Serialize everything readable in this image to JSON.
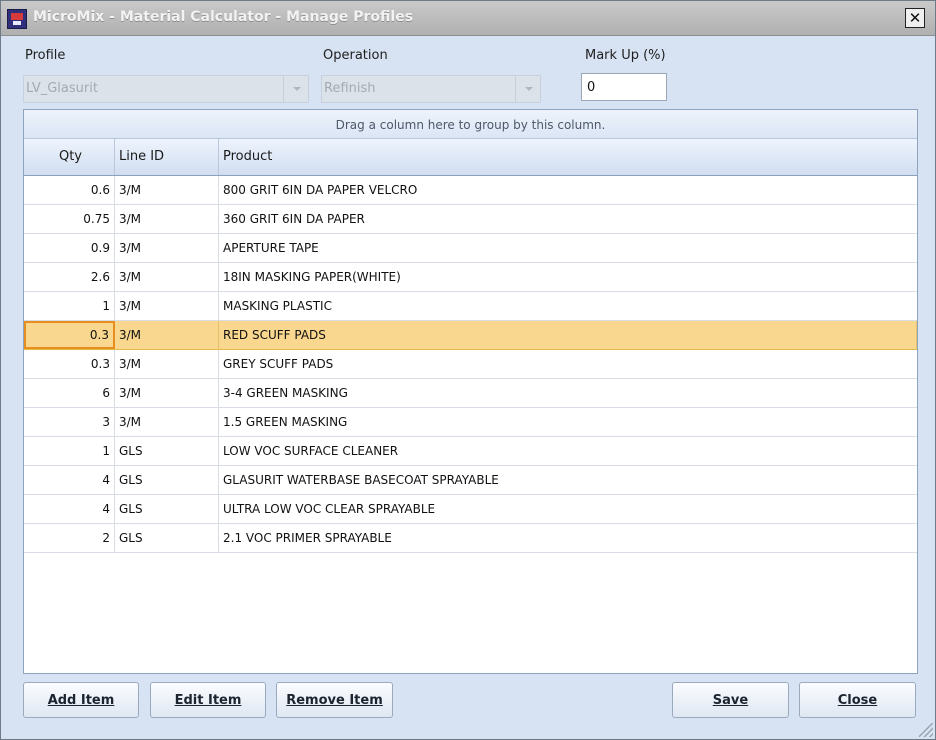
{
  "window": {
    "title": "MicroMix - Material Calculator - Manage Profiles",
    "close_symbol": "✕"
  },
  "filters": {
    "profile_label": "Profile",
    "profile_value": "LV_Glasurit",
    "operation_label": "Operation",
    "operation_value": "Refinish",
    "markup_label": "Mark Up (%)",
    "markup_value": "0"
  },
  "grid": {
    "group_hint": "Drag a column here to group by this column.",
    "columns": [
      "Qty",
      "Line ID",
      "Product"
    ],
    "rows": [
      {
        "qty": "0.6",
        "line_id": "3/M",
        "product": "800 GRIT 6IN DA PAPER VELCRO"
      },
      {
        "qty": "0.75",
        "line_id": "3/M",
        "product": "360 GRIT 6IN DA PAPER"
      },
      {
        "qty": "0.9",
        "line_id": "3/M",
        "product": "APERTURE TAPE"
      },
      {
        "qty": "2.6",
        "line_id": "3/M",
        "product": "18IN MASKING PAPER(WHITE)"
      },
      {
        "qty": "1",
        "line_id": "3/M",
        "product": "MASKING PLASTIC"
      },
      {
        "qty": "0.3",
        "line_id": "3/M",
        "product": "RED SCUFF PADS"
      },
      {
        "qty": "0.3",
        "line_id": "3/M",
        "product": "GREY SCUFF PADS"
      },
      {
        "qty": "6",
        "line_id": "3/M",
        "product": "3-4 GREEN MASKING"
      },
      {
        "qty": "3",
        "line_id": "3/M",
        "product": "1.5 GREEN MASKING"
      },
      {
        "qty": "1",
        "line_id": "GLS",
        "product": "LOW VOC SURFACE CLEANER"
      },
      {
        "qty": "4",
        "line_id": "GLS",
        "product": "GLASURIT WATERBASE BASECOAT SPRAYABLE"
      },
      {
        "qty": "4",
        "line_id": "GLS",
        "product": "ULTRA LOW VOC CLEAR SPRAYABLE"
      },
      {
        "qty": "2",
        "line_id": "GLS",
        "product": "2.1 VOC PRIMER SPRAYABLE"
      }
    ],
    "selected_row_index": 5
  },
  "buttons": {
    "add": "Add Item",
    "edit": "Edit Item",
    "remove": "Remove Item",
    "save": "Save",
    "close": "Close"
  },
  "colors": {
    "selection": "#f9d78e",
    "selection_border": "#e68f1f",
    "window_bg": "#d7e3f2"
  },
  "icons": {
    "app": "micromix-app-icon",
    "close": "close-icon",
    "dropdown": "chevron-down-icon",
    "resize": "resize-grip-icon"
  }
}
